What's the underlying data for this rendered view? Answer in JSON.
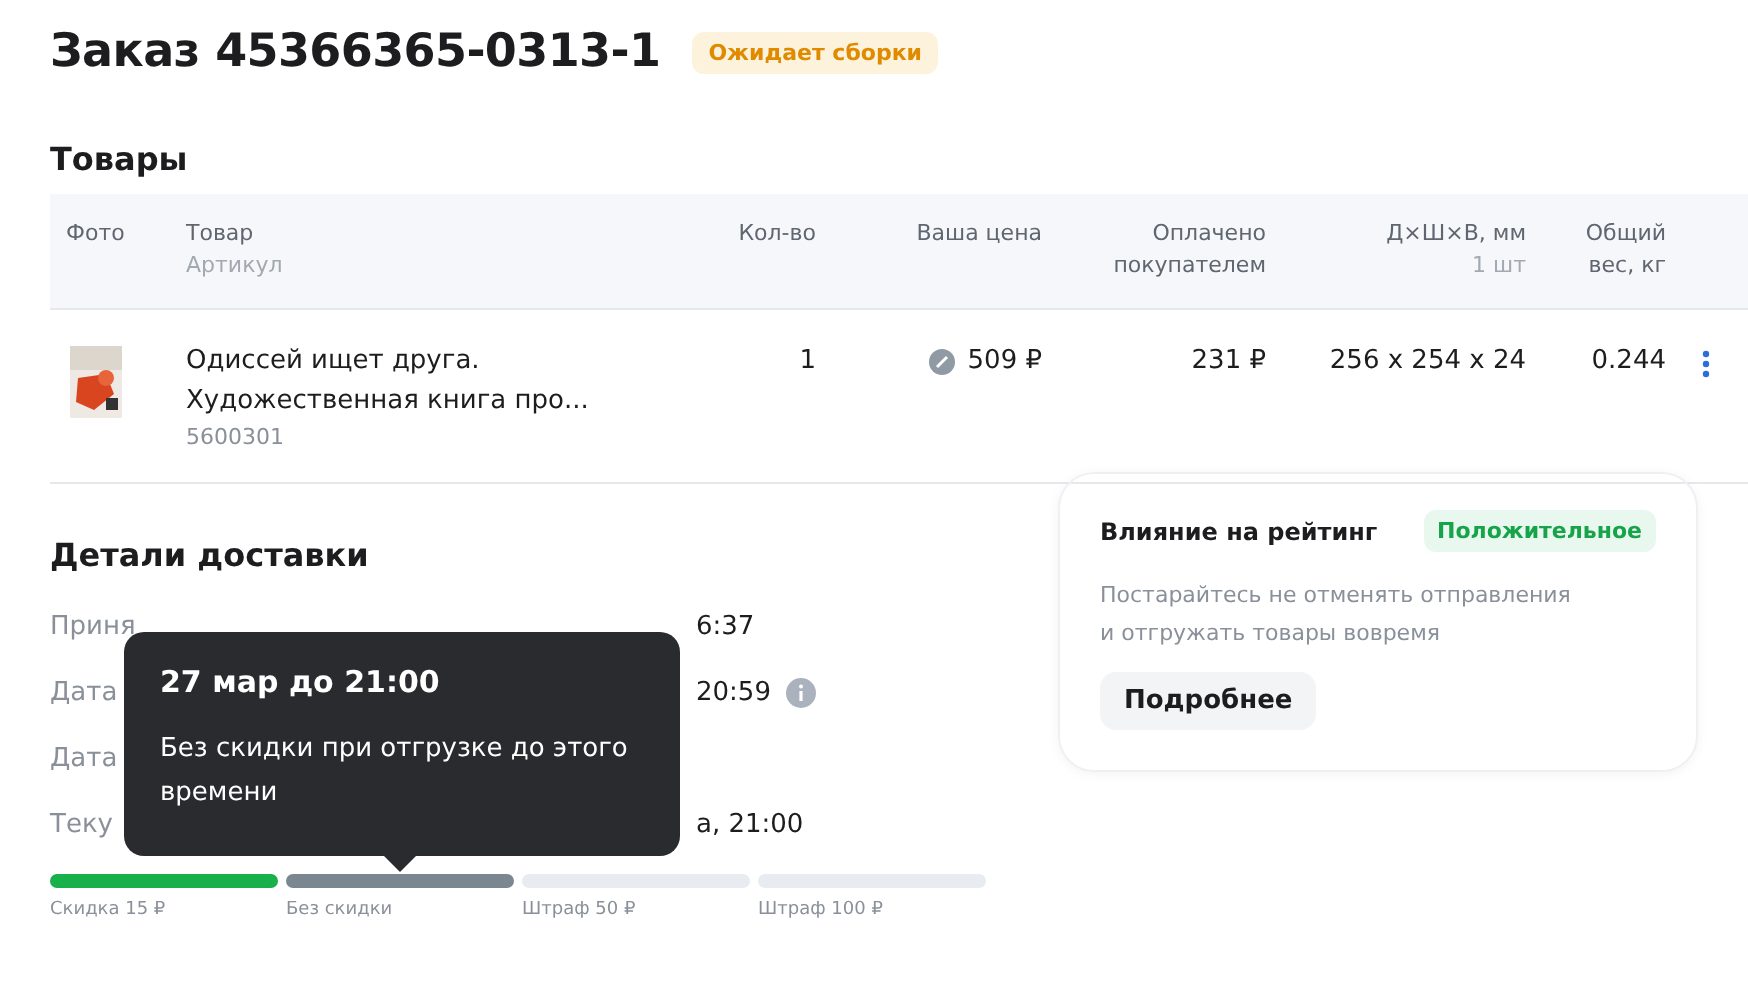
{
  "title": "Заказ 45366365-0313-1",
  "status_badge": "Ожидает сборки",
  "products": {
    "heading": "Товары",
    "columns": [
      {
        "label": "Фото"
      },
      {
        "label": "Товар",
        "sub": "Артикул"
      },
      {
        "label": "Кол-во"
      },
      {
        "label": "Ваша цена"
      },
      {
        "label": "Оплачено покупателем"
      },
      {
        "label": "Д×Ш×В, мм",
        "sub": "1 шт"
      },
      {
        "label": "Общий вес, кг"
      }
    ],
    "rows": [
      {
        "kind": "picture",
        "name": "Одиссей ищет друга. Художественная книга про...",
        "sku": "5600301",
        "qty": "1",
        "price": "509 ₽",
        "paid": "231 ₽",
        "dims": "256 x 254 x 24",
        "weight": "0.244"
      }
    ]
  },
  "delivery": {
    "heading": "Детали доставки",
    "rows": [
      {
        "kind": "plain",
        "label": "Приня",
        "value": "6:37"
      },
      {
        "kind": "info",
        "label": "Дата",
        "value": "20:59"
      },
      {
        "kind": "plain",
        "label": "Дата"
      },
      {
        "kind": "plain",
        "label": "Теку",
        "value": "а, 21:00"
      }
    ],
    "segments": [
      {
        "label": "Скидка 15 ₽",
        "color": "#17b04a"
      },
      {
        "label": "Без скидки",
        "color": "#7a8791"
      },
      {
        "label": "Штраф 50 ₽",
        "color": "#e8ebef"
      },
      {
        "label": "Штраф 100 ₽",
        "color": "#e8ebef"
      }
    ],
    "tooltip": {
      "title": "27 мар до 21:00",
      "text": "Без скидки при отгрузке до этого времени"
    }
  },
  "rating": {
    "title": "Влияние на рейтинг",
    "badge": "Положительное",
    "text": "Постарайтесь не отменять отправления и отгружать товары вовремя",
    "button": "Подробнее"
  }
}
